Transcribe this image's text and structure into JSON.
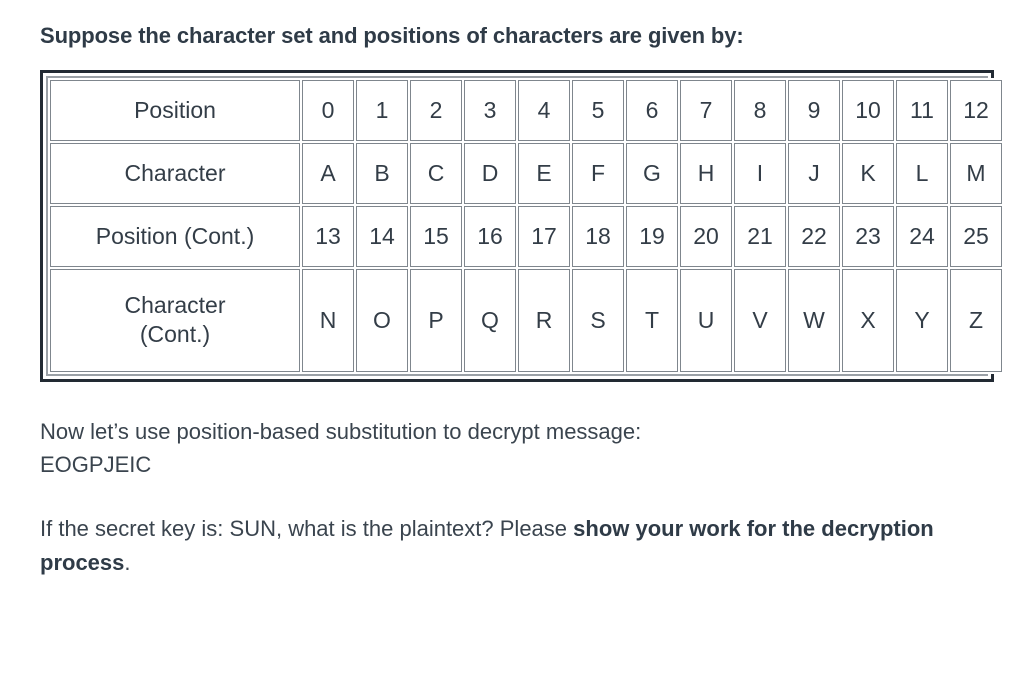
{
  "intro": {
    "heading": "Suppose the character set and positions of characters are given by:"
  },
  "table": {
    "rows": [
      {
        "label": "Position",
        "cells": [
          "0",
          "1",
          "2",
          "3",
          "4",
          "5",
          "6",
          "7",
          "8",
          "9",
          "10",
          "11",
          "12"
        ]
      },
      {
        "label": "Character",
        "cells": [
          "A",
          "B",
          "C",
          "D",
          "E",
          "F",
          "G",
          "H",
          "I",
          "J",
          "K",
          "L",
          "M"
        ]
      },
      {
        "label": "Position (Cont.)",
        "cells": [
          "13",
          "14",
          "15",
          "16",
          "17",
          "18",
          "19",
          "20",
          "21",
          "22",
          "23",
          "24",
          "25"
        ]
      },
      {
        "label_line1": "Character",
        "label_line2": "(Cont.)",
        "cells": [
          "N",
          "O",
          "P",
          "Q",
          "R",
          "S",
          "T",
          "U",
          "V",
          "W",
          "X",
          "Y",
          "Z"
        ]
      }
    ]
  },
  "paragraphs": {
    "decrypt_intro": "Now let’s use position-based substitution to decrypt message:",
    "ciphertext": "EOGPJEIC",
    "question_prefix": "If the secret key is: SUN, what is the plaintext? Please ",
    "question_bold": "show your work for the decryption process",
    "question_suffix": "."
  },
  "colors": {
    "text": "#333d47",
    "table_outer_border": "#222a33",
    "table_inner_border": "#9aa0a6",
    "cell_border": "#7f868d",
    "background": "#ffffff"
  }
}
